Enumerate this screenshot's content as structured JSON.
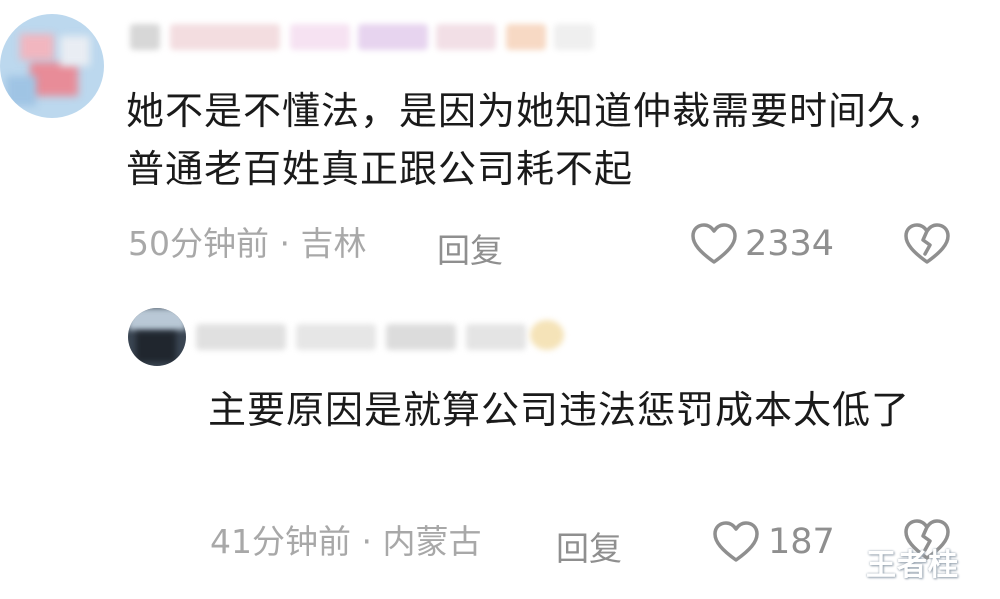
{
  "comment": {
    "text": "她不是不懂法，是因为她知道仲裁需要时间久，普通老百姓真正跟公司耗不起",
    "time": "50分钟前",
    "separator": "·",
    "location": "吉林",
    "reply_label": "回复",
    "likes": "2334"
  },
  "reply": {
    "text": "主要原因是就算公司违法惩罚成本太低了",
    "time": "41分钟前",
    "separator": "·",
    "location": "内蒙古",
    "reply_label": "回复",
    "likes": "187"
  },
  "watermark": "王者桂",
  "icons": {
    "like": "heart-outline-icon",
    "dislike": "broken-heart-icon"
  },
  "colors": {
    "text": "#1a1a1a",
    "meta": "#a8a8a8",
    "icon": "#8f8f8f"
  }
}
